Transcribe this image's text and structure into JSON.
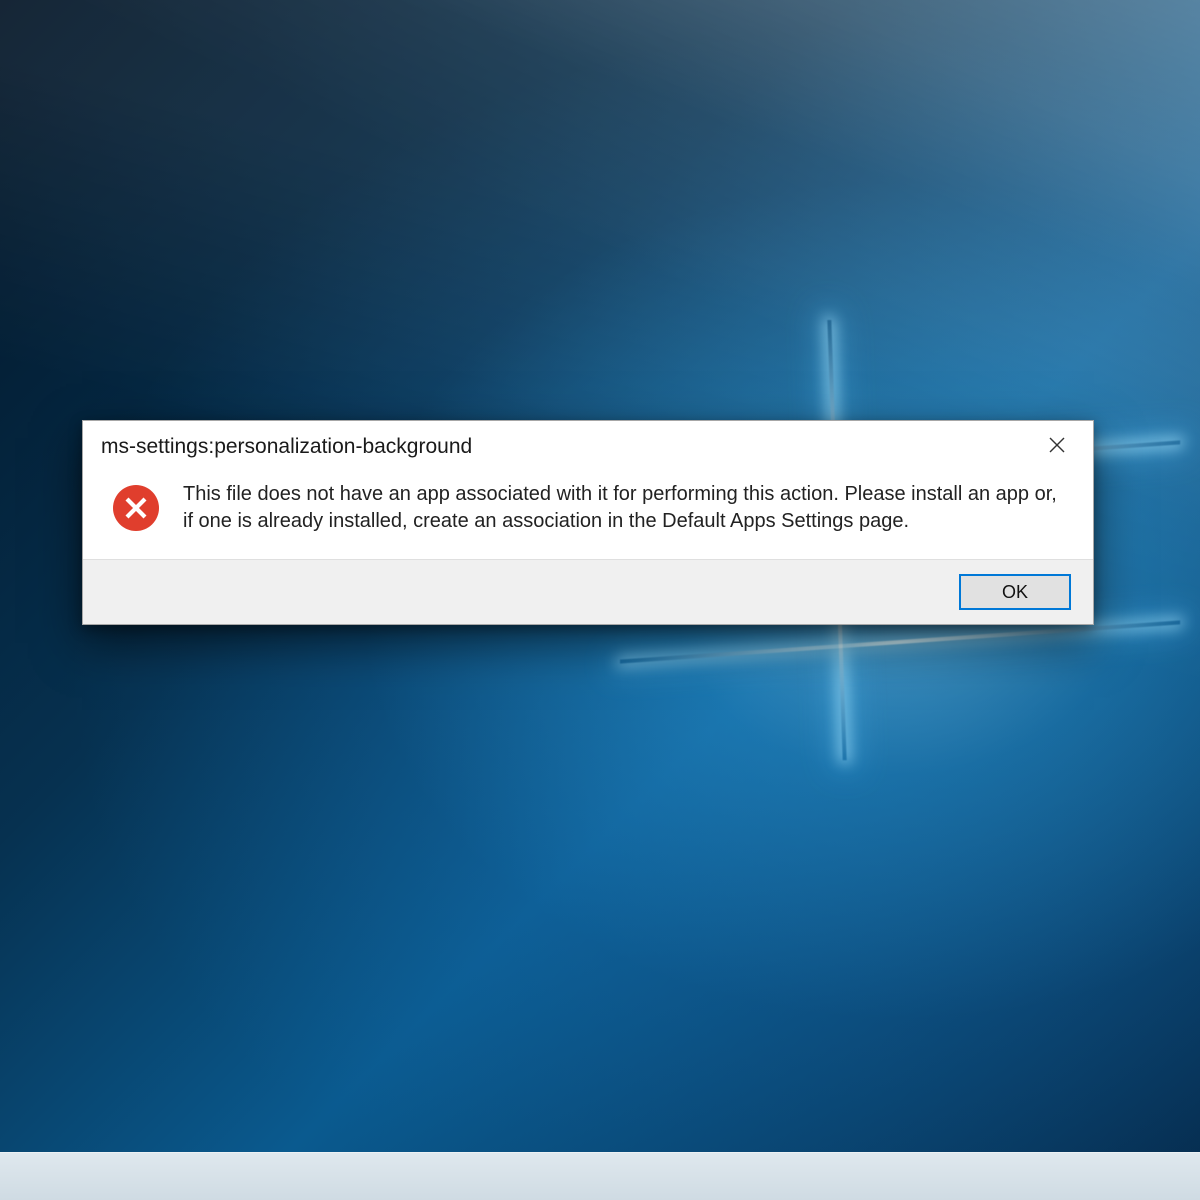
{
  "dialog": {
    "title": "ms-settings:personalization-background",
    "icon": "error-icon",
    "message": "This file does not have an app associated with it for performing this action. Please install an app or, if one is already installed, create an association in the Default Apps Settings page.",
    "ok_label": "OK"
  }
}
